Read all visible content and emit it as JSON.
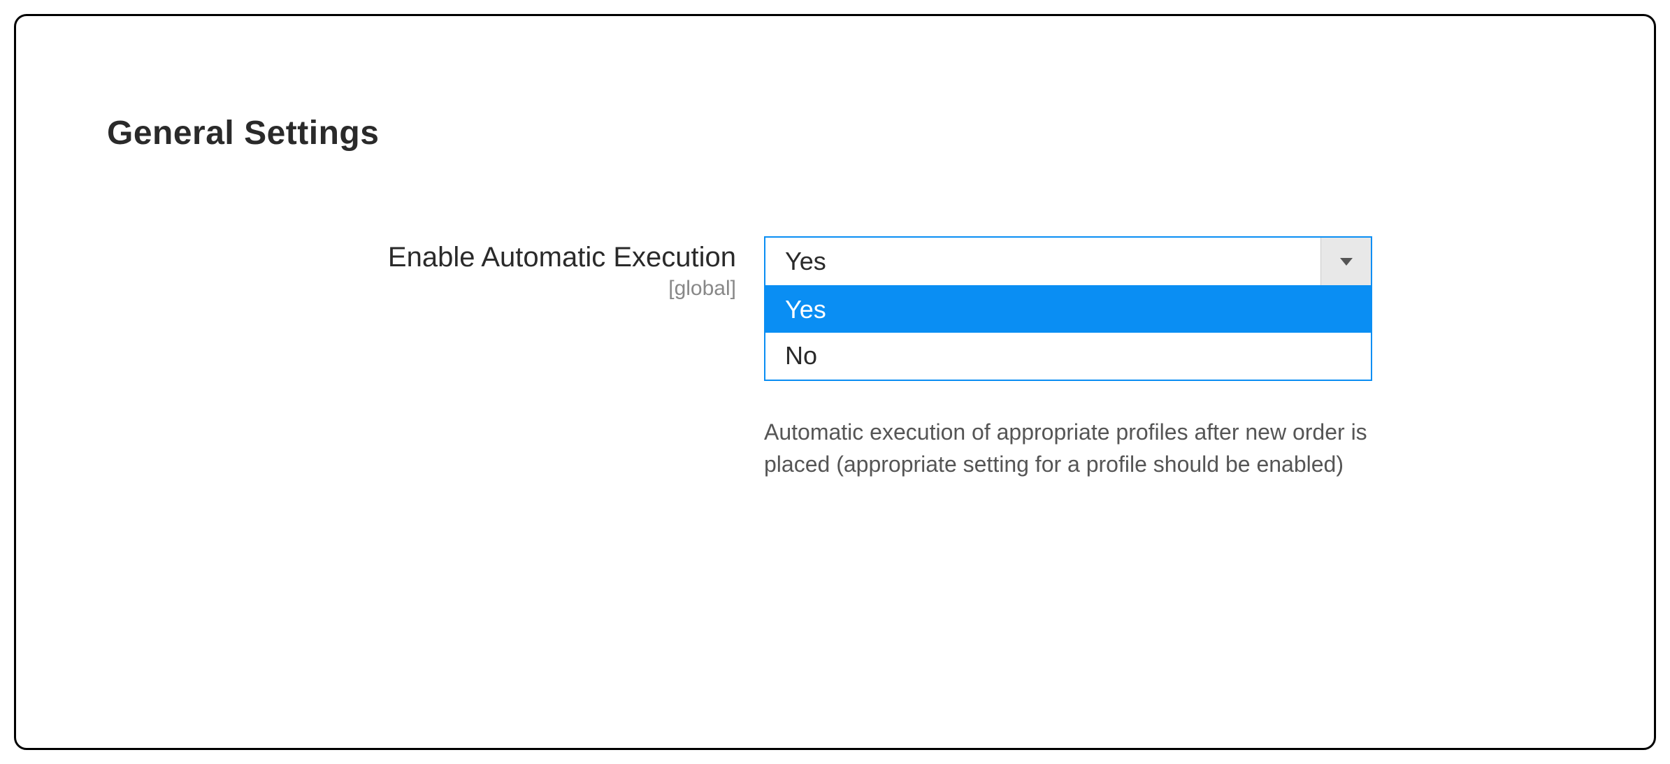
{
  "section": {
    "title": "General Settings"
  },
  "field": {
    "label": "Enable Automatic Execution",
    "scope": "[global]",
    "selected_value": "Yes",
    "options": {
      "yes": "Yes",
      "no": "No"
    },
    "help_text": "Automatic execution of appropriate profiles after new order is placed (appropriate setting for a profile should be enabled)"
  },
  "colors": {
    "accent": "#0a8ef3"
  }
}
